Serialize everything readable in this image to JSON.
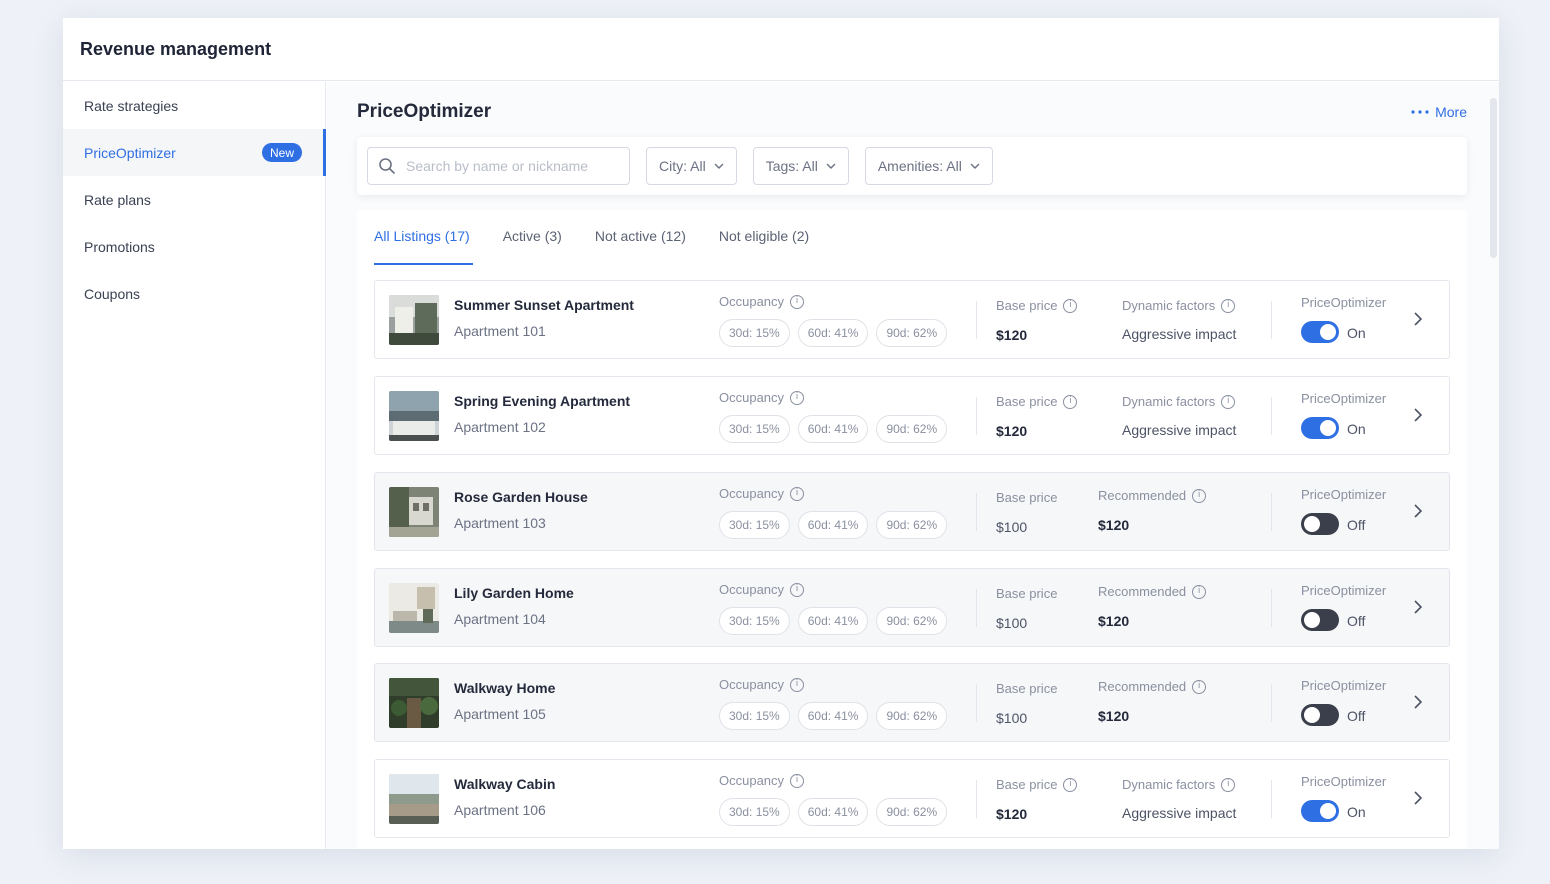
{
  "app": {
    "title": "Revenue management"
  },
  "sidebar": {
    "items": [
      {
        "label": "Rate strategies"
      },
      {
        "label": "PriceOptimizer",
        "badge": "New",
        "active": true
      },
      {
        "label": "Rate plans"
      },
      {
        "label": "Promotions"
      },
      {
        "label": "Coupons"
      }
    ]
  },
  "main": {
    "title": "PriceOptimizer",
    "more_label": "More"
  },
  "filters": {
    "search_placeholder": "Search by name or nickname",
    "city": "City: All",
    "tags": "Tags: All",
    "amenities": "Amenities: All"
  },
  "tabs": [
    {
      "label": "All Listings (17)",
      "active": true
    },
    {
      "label": "Active (3)"
    },
    {
      "label": "Not active (12)"
    },
    {
      "label": "Not eligible (2)"
    }
  ],
  "labels": {
    "occupancy": "Occupancy",
    "base_price": "Base price",
    "dynamic_factors": "Dynamic factors",
    "recommended": "Recommended",
    "price_optimizer": "PriceOptimizer",
    "on": "On",
    "off": "Off"
  },
  "colors": {
    "accent": "#2f6fe4",
    "toggle_off": "#3a3f4b"
  },
  "listings": [
    {
      "name": "Summer Sunset Apartment",
      "unit": "Apartment 101",
      "occ": [
        "30d: 15%",
        "60d: 41%",
        "90d: 62%"
      ],
      "base_price": "$120",
      "dynamic": "Aggressive impact",
      "enabled": true
    },
    {
      "name": "Spring Evening Apartment",
      "unit": "Apartment 102",
      "occ": [
        "30d: 15%",
        "60d: 41%",
        "90d: 62%"
      ],
      "base_price": "$120",
      "dynamic": "Aggressive impact",
      "enabled": true
    },
    {
      "name": "Rose Garden House",
      "unit": "Apartment 103",
      "occ": [
        "30d: 15%",
        "60d: 41%",
        "90d: 62%"
      ],
      "base_price": "$100",
      "recommended": "$120",
      "enabled": false
    },
    {
      "name": "Lily Garden Home",
      "unit": "Apartment 104",
      "occ": [
        "30d: 15%",
        "60d: 41%",
        "90d: 62%"
      ],
      "base_price": "$100",
      "recommended": "$120",
      "enabled": false
    },
    {
      "name": "Walkway Home",
      "unit": "Apartment 105",
      "occ": [
        "30d: 15%",
        "60d: 41%",
        "90d: 62%"
      ],
      "base_price": "$100",
      "recommended": "$120",
      "enabled": false
    },
    {
      "name": "Walkway Cabin",
      "unit": "Apartment 106",
      "occ": [
        "30d: 15%",
        "60d: 41%",
        "90d: 62%"
      ],
      "base_price": "$120",
      "dynamic": "Aggressive impact",
      "enabled": true
    }
  ]
}
